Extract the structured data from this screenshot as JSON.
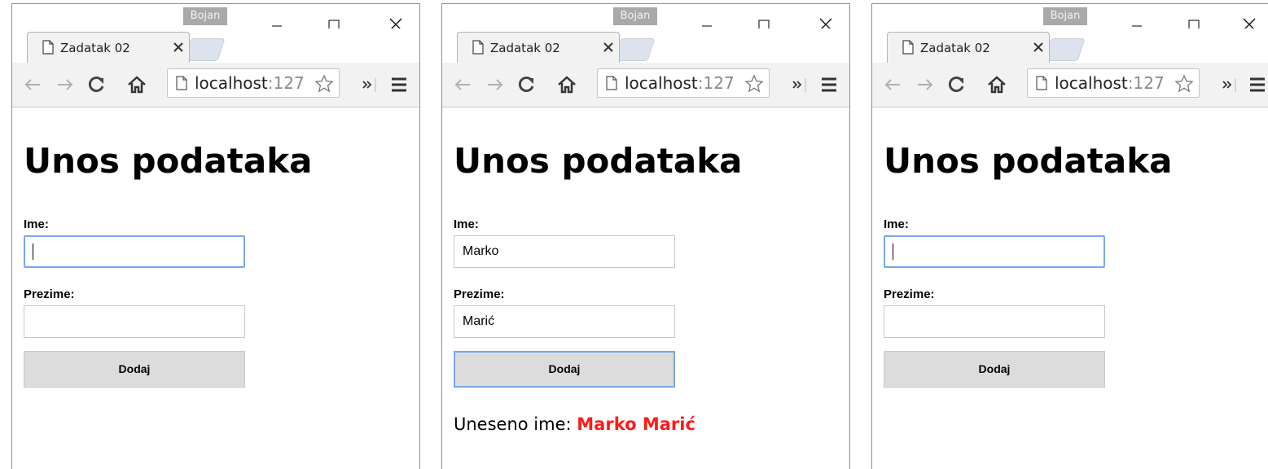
{
  "windows": [
    {
      "profile": "Bojan",
      "tab_title": "Zadatak 02",
      "url_host": "localhost",
      "url_rest": ":127",
      "heading": "Unos podataka",
      "ime_label": "Ime:",
      "ime_value": "",
      "prezime_label": "Prezime:",
      "prezime_value": "",
      "button": "Dodaj",
      "result_prefix": "",
      "result_name": ""
    },
    {
      "profile": "Bojan",
      "tab_title": "Zadatak 02",
      "url_host": "localhost",
      "url_rest": ":127",
      "heading": "Unos podataka",
      "ime_label": "Ime:",
      "ime_value": "Marko",
      "prezime_label": "Prezime:",
      "prezime_value": "Marić",
      "button": "Dodaj",
      "result_prefix": "Uneseno ime: ",
      "result_name": "Marko Marić"
    },
    {
      "profile": "Bojan",
      "tab_title": "Zadatak 02",
      "url_host": "localhost",
      "url_rest": ":127",
      "heading": "Unos podataka",
      "ime_label": "Ime:",
      "ime_value": "",
      "prezime_label": "Prezime:",
      "prezime_value": "",
      "button": "Dodaj",
      "result_prefix": "",
      "result_name": ""
    }
  ],
  "colors": {
    "result_name": "#ff1a1a",
    "focus_ring": "#7aa7e8",
    "window_border": "#5b9bd5"
  },
  "icons": [
    "page-icon",
    "close-icon",
    "back-icon",
    "forward-icon",
    "reload-icon",
    "home-icon",
    "star-icon",
    "extensions-icon",
    "menu-icon",
    "minimize-icon",
    "maximize-icon",
    "window-close-icon"
  ]
}
